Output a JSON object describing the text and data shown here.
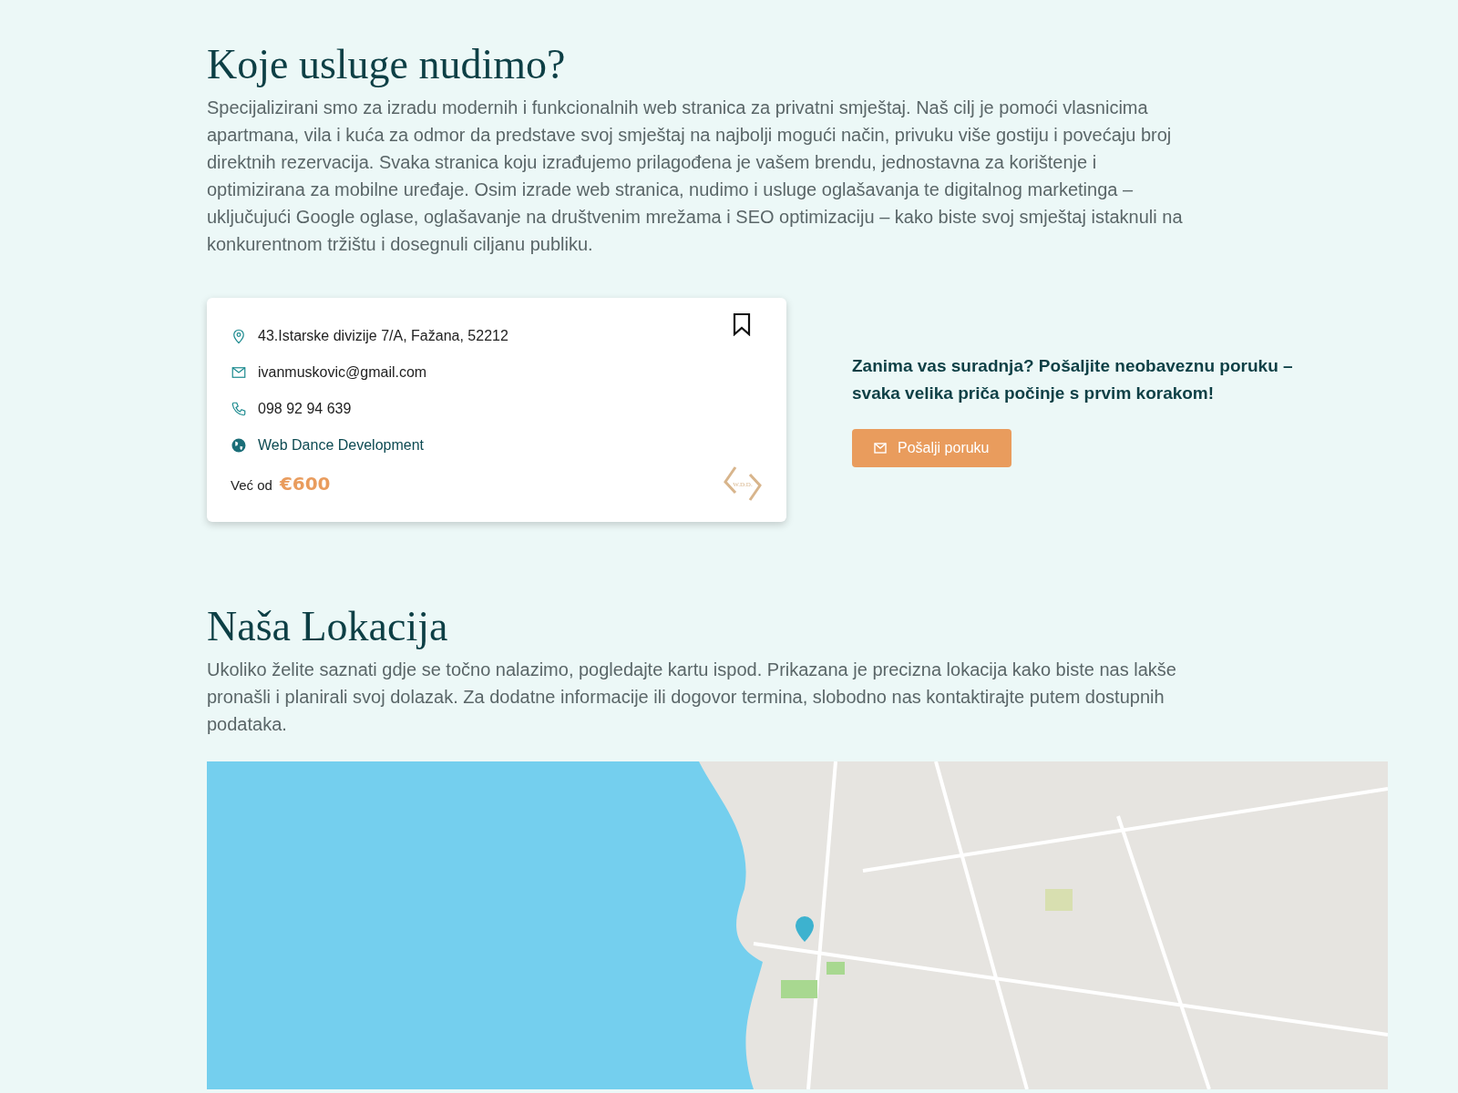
{
  "services": {
    "heading": "Koje usluge nudimo?",
    "text": "Specijalizirani smo za izradu modernih i funkcionalnih web stranica za privatni smještaj. Naš cilj je pomoći vlasnicima apartmana, vila i kuća za odmor da predstave svoj smještaj na najbolji mogući način, privuku više gostiju i povećaju broj direktnih rezervacija. Svaka stranica koju izrađujemo prilagođena je vašem brendu, jednostavna za korištenje i optimizirana za mobilne uređaje. Osim izrade web stranica, nudimo i usluge oglašavanja te digitalnog marketinga – uključujući Google oglase, oglašavanje na društvenim mrežama i SEO optimizaciju – kako biste svoj smještaj istaknuli na konkurentnom tržištu i dosegnuli ciljanu publiku."
  },
  "card": {
    "contacts": [
      {
        "kind": "address",
        "text": "43.Istarske divizije 7/A, Fažana, 52212"
      },
      {
        "kind": "email",
        "text": "ivanmuskovic@gmail.com"
      },
      {
        "kind": "phone",
        "text": "098 92 94 639"
      },
      {
        "kind": "website",
        "text": "Web Dance Development"
      }
    ],
    "price_label": "Već od",
    "price": "€600",
    "logo_text": "W.D.D."
  },
  "cta": {
    "text": "Zanima vas suradnja? Pošaljite neobaveznu poruku – svaka velika priča počinje s prvim korakom!",
    "button": "Pošalji poruku"
  },
  "location": {
    "heading": "Naša Lokacija",
    "text": "Ukoliko želite saznati gdje se točno nalazimo, pogledajte kartu ispod. Prikazana je precizna lokacija kako biste nas lakše pronašli i planirali svoj dolazak. Za dodatne informacije ili dogovor termina, slobodno nas kontaktirajte putem dostupnih podataka."
  }
}
